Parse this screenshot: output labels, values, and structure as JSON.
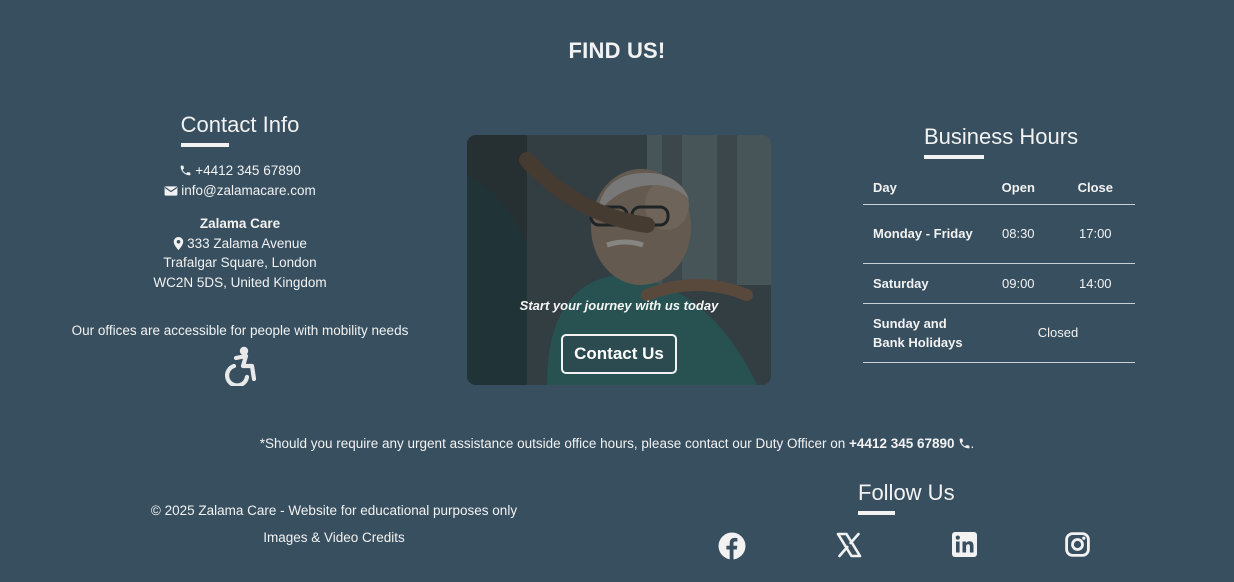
{
  "page": {
    "title": "FIND US!"
  },
  "contact": {
    "heading": "Contact Info",
    "phone": "+4412 345 67890",
    "email": "info@zalamacare.com",
    "company": "Zalama Care",
    "address_line1": "333 Zalama Avenue",
    "address_line2": "Trafalgar Square, London",
    "address_line3": "WC2N 5DS, United Kingdom",
    "accessibility": "Our offices are accessible for people with mobility needs",
    "accessibility_icon": "wheelchair-icon"
  },
  "card": {
    "tagline": "Start your journey with us today",
    "button_label": "Contact Us"
  },
  "hours": {
    "heading": "Business Hours",
    "columns": [
      "Day",
      "Open",
      "Close"
    ],
    "rows": [
      {
        "day": "Monday - Friday",
        "open": "08:30",
        "close": "17:00"
      },
      {
        "day": "Saturday",
        "open": "09:00",
        "close": "14:00"
      },
      {
        "day": "Sunday and Bank Holidays",
        "status": "Closed"
      }
    ]
  },
  "footer": {
    "urgent_prefix": "*Should you require any urgent assistance outside office hours, please contact our Duty Officer on ",
    "urgent_phone": "+4412 345 67890",
    "urgent_suffix": ".",
    "copyright": "© 2025 Zalama Care - Website for educational purposes only",
    "credits": "Images & Video Credits",
    "follow_heading": "Follow Us",
    "socials": [
      "facebook-icon",
      "x-twitter-icon",
      "linkedin-icon",
      "instagram-icon"
    ]
  }
}
